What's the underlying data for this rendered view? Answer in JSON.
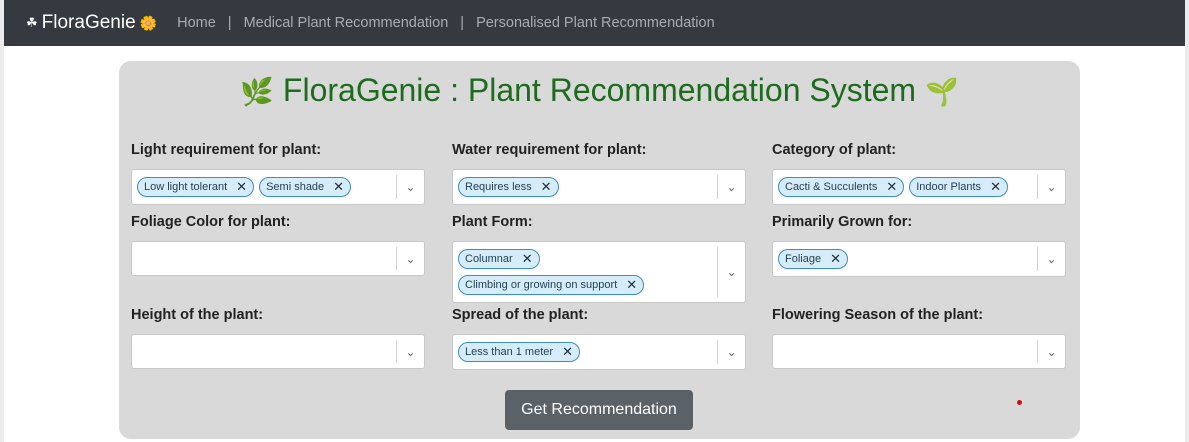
{
  "nav": {
    "brand": "FloraGenie",
    "brand_icon_left": "☘",
    "brand_icon_right": "🌼",
    "links": [
      "Home",
      "Medical Plant Recommendation",
      "Personalised Plant Recommendation"
    ],
    "separator": "|"
  },
  "main": {
    "title": "FloraGenie : Plant Recommendation System",
    "title_icon_left": "🌿",
    "title_icon_right": "🌱",
    "button_label": "Get Recommendation"
  },
  "fields": [
    {
      "label": "Light requirement for plant:",
      "chips": [
        "Low light tolerant",
        "Semi shade"
      ]
    },
    {
      "label": "Water requirement for plant:",
      "chips": [
        "Requires less"
      ]
    },
    {
      "label": "Category of plant:",
      "chips": [
        "Cacti & Succulents",
        "Indoor Plants"
      ]
    },
    {
      "label": "Foliage Color for plant:",
      "chips": []
    },
    {
      "label": "Plant Form:",
      "chips": [
        "Columnar",
        "Climbing or growing on support"
      ]
    },
    {
      "label": "Primarily Grown for:",
      "chips": [
        "Foliage"
      ]
    },
    {
      "label": "Height of the plant:",
      "chips": []
    },
    {
      "label": "Spread of the plant:",
      "chips": [
        "Less than 1 meter"
      ]
    },
    {
      "label": "Flowering Season of the plant:",
      "chips": []
    }
  ],
  "icons": {
    "remove": "✕",
    "dropdown": "⌄"
  },
  "colors": {
    "navbar": "#343a40",
    "title": "#1d6b1d",
    "chip_bg": "#d6ecf8",
    "chip_border": "#3d8dc4",
    "button": "#5a6268"
  }
}
